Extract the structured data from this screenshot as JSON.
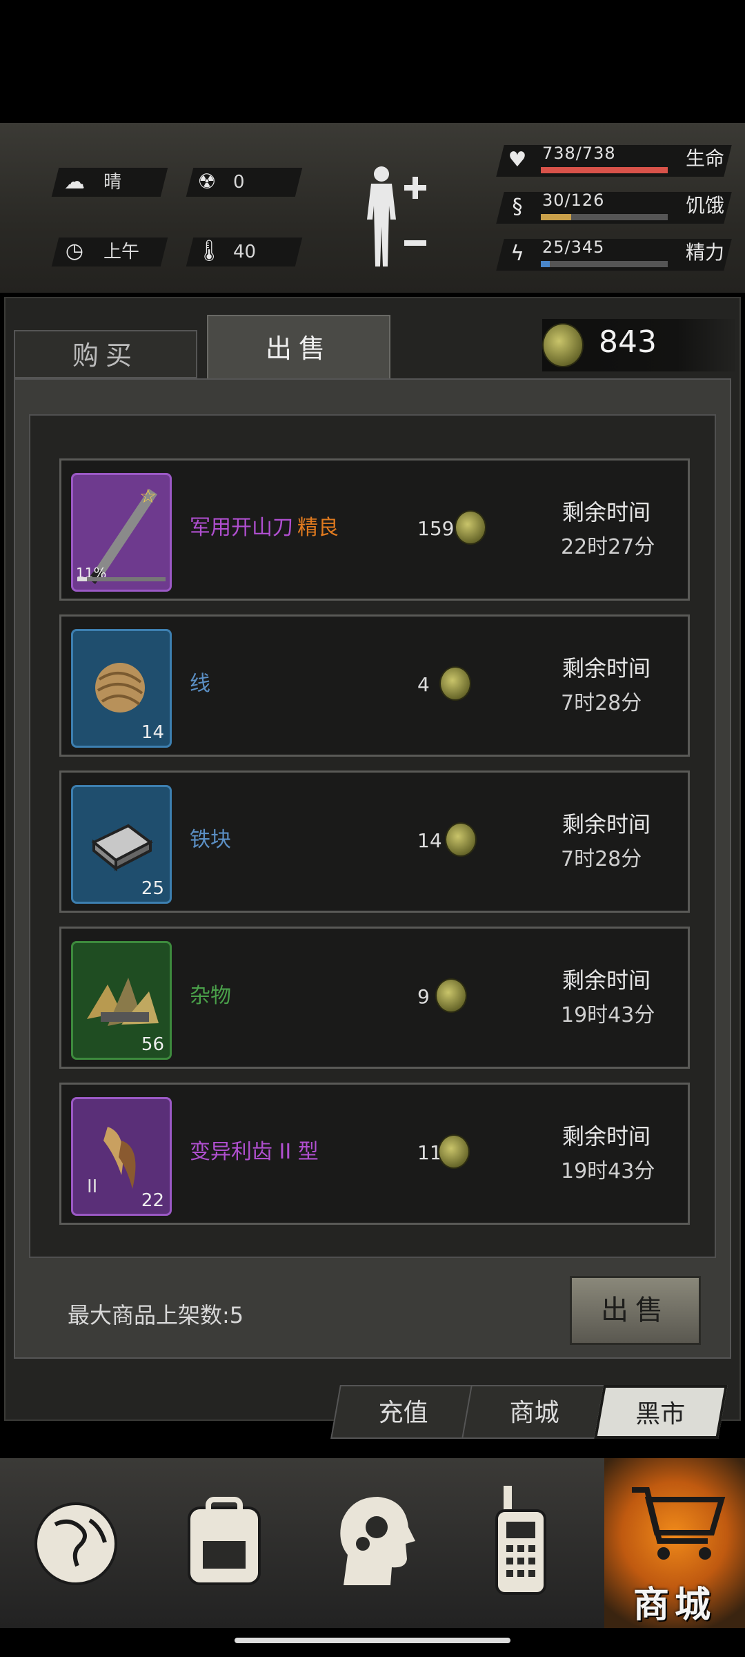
{
  "status": {
    "weather": "晴",
    "radiation": "0",
    "time_of_day": "上午",
    "temperature": "40",
    "health": {
      "value": "738/738",
      "label": "生命",
      "fraction": 1.0,
      "color": "#d9534a"
    },
    "hunger": {
      "value": "30/126",
      "label": "饥饿",
      "fraction": 0.238,
      "color": "#c9a04a"
    },
    "energy": {
      "value": "25/345",
      "label": "精力",
      "fraction": 0.072,
      "color": "#4a86c9"
    }
  },
  "tabs": {
    "buy": "购买",
    "sell": "出售"
  },
  "currency": {
    "amount": "843",
    "icon": "bottle-cap-coin-icon"
  },
  "listings": [
    {
      "name": "军用开山刀",
      "quality": "精良",
      "rarity_color": "#b04fd0",
      "quality_color": "#e07a1f",
      "thumb_color": "#6e3a8e",
      "thumb_border": "#9b59c5",
      "badge": "11%",
      "icon": "machete-icon",
      "price": "159",
      "remaining_label": "剩余时间",
      "remaining": "22时27分"
    },
    {
      "name": "线",
      "quality": "",
      "rarity_color": "#5b8fc4",
      "quality_color": "",
      "thumb_color": "#1f4e6e",
      "thumb_border": "#3d7fb0",
      "qty": "14",
      "icon": "yarn-ball-icon",
      "price": "4",
      "remaining_label": "剩余时间",
      "remaining": "7时28分"
    },
    {
      "name": "铁块",
      "quality": "",
      "rarity_color": "#5b8fc4",
      "quality_color": "",
      "thumb_color": "#1f4e6e",
      "thumb_border": "#3d7fb0",
      "qty": "25",
      "icon": "iron-bar-icon",
      "price": "14",
      "remaining_label": "剩余时间",
      "remaining": "7时28分"
    },
    {
      "name": "杂物",
      "quality": "",
      "rarity_color": "#4aa04a",
      "quality_color": "",
      "thumb_color": "#1f4d22",
      "thumb_border": "#3d8a3d",
      "qty": "56",
      "icon": "junk-pile-icon",
      "price": "9",
      "remaining_label": "剩余时间",
      "remaining": "19时43分"
    },
    {
      "name": "变异利齿 II 型",
      "quality": "",
      "rarity_color": "#b04fd0",
      "quality_color": "",
      "thumb_color": "#5a2f78",
      "thumb_border": "#9b59c5",
      "qty": "22",
      "tier": "II",
      "icon": "mutant-fang-icon",
      "price": "11",
      "remaining_label": "剩余时间",
      "remaining": "19时43分"
    }
  ],
  "max_listings": "最大商品上架数:5",
  "sell_button": "出售",
  "shop_tabs": [
    "充值",
    "商城",
    "黑市"
  ],
  "nav": {
    "items": [
      "globe-icon",
      "backpack-icon",
      "brain-skills-icon",
      "walkie-talkie-icon",
      "cart-icon"
    ],
    "active_label": "商城"
  }
}
